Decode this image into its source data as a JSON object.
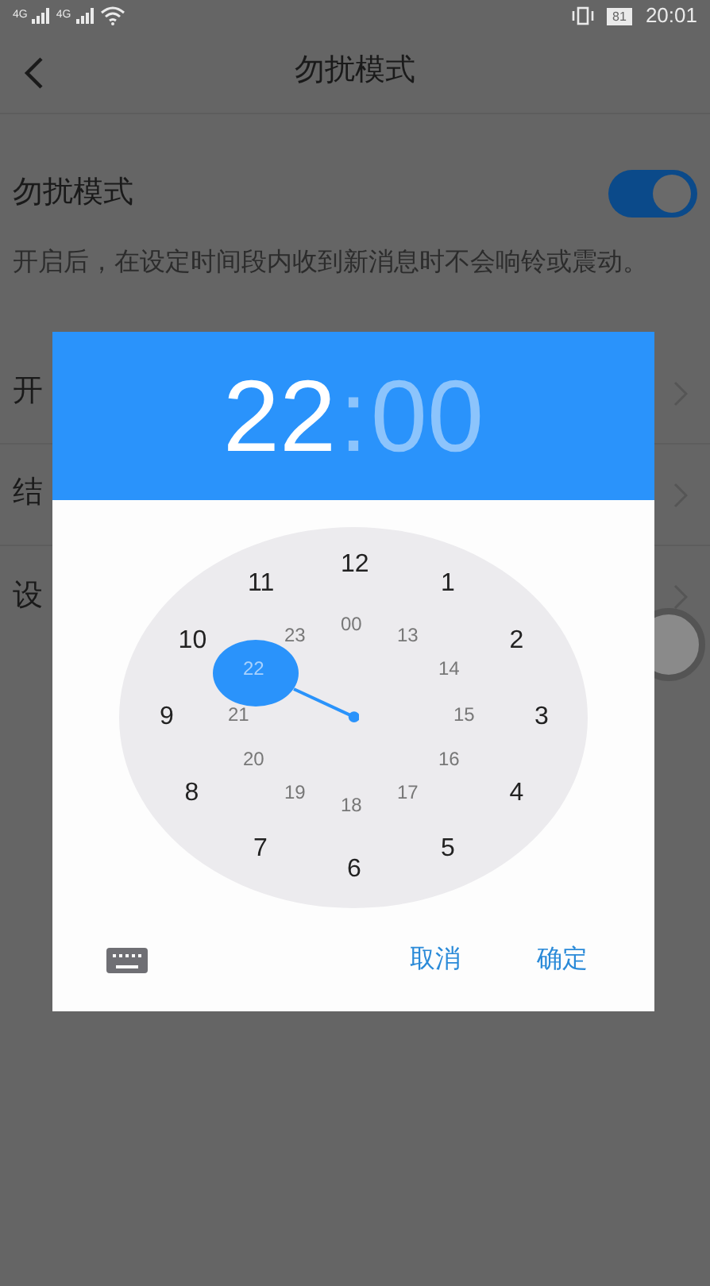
{
  "status_bar": {
    "network_1": "4G",
    "network_2": "4G",
    "battery": "81",
    "time": "20:01"
  },
  "header": {
    "title": "勿扰模式"
  },
  "dnd_row": {
    "label": "勿扰模式",
    "on": true
  },
  "description": "开启后，在设定时间段内收到新消息时不会响铃或震动。",
  "rows": [
    {
      "label": "开"
    },
    {
      "label": "结"
    },
    {
      "label": "设"
    }
  ],
  "dialog": {
    "hour": {
      "text": "22",
      "selected": true
    },
    "separator": ":",
    "minute": {
      "text": "00",
      "selected": false
    },
    "dial_outer": [
      {
        "text": "12",
        "selected": false
      },
      {
        "text": "1",
        "selected": false
      },
      {
        "text": "2",
        "selected": false
      },
      {
        "text": "3",
        "selected": false
      },
      {
        "text": "4",
        "selected": false
      },
      {
        "text": "5",
        "selected": false
      },
      {
        "text": "6",
        "selected": false
      },
      {
        "text": "7",
        "selected": false
      },
      {
        "text": "8",
        "selected": false
      },
      {
        "text": "9",
        "selected": false
      },
      {
        "text": "10",
        "selected": false
      },
      {
        "text": "11",
        "selected": false
      }
    ],
    "dial_inner": [
      {
        "text": "00",
        "selected": false
      },
      {
        "text": "13",
        "selected": false
      },
      {
        "text": "14",
        "selected": false
      },
      {
        "text": "15",
        "selected": false
      },
      {
        "text": "16",
        "selected": false
      },
      {
        "text": "17",
        "selected": false
      },
      {
        "text": "18",
        "selected": false
      },
      {
        "text": "19",
        "selected": false
      },
      {
        "text": "20",
        "selected": false
      },
      {
        "text": "21",
        "selected": false
      },
      {
        "text": "22",
        "selected": true
      },
      {
        "text": "23",
        "selected": false
      }
    ],
    "buttons": [
      "取消",
      "确定"
    ]
  }
}
